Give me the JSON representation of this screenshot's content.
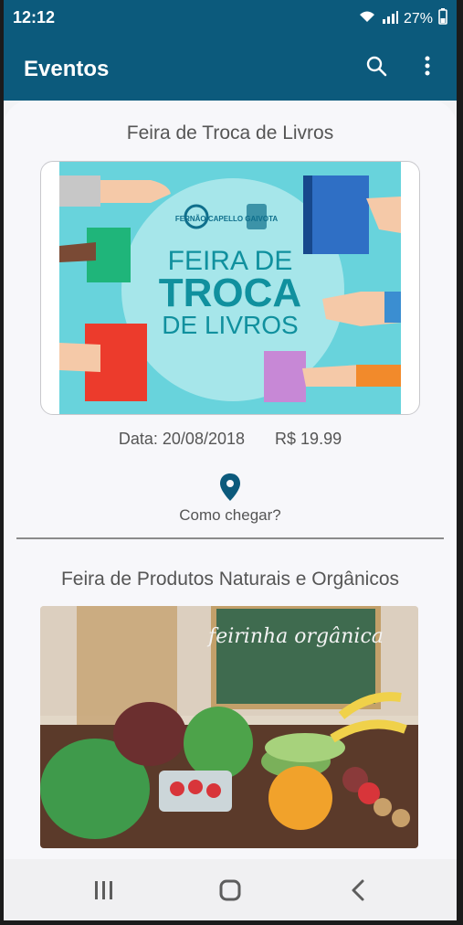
{
  "status": {
    "time": "12:12",
    "battery": "27%"
  },
  "appbar": {
    "title": "Eventos"
  },
  "events": [
    {
      "title": "Feira de Troca de Livros",
      "date_label": "Data: 20/08/2018",
      "price_label": "R$ 19.99",
      "directions": "Como chegar?",
      "banner": {
        "line1": "FEIRA DE",
        "line2": "TROCA",
        "line3": "DE LIVROS",
        "brand": "FERNÃO CAPELLO GAIVOTA"
      }
    },
    {
      "title": "Feira de Produtos Naturais e Orgânicos",
      "image_text": "feirinha orgânica"
    }
  ],
  "colors": {
    "primary": "#0c5a7c",
    "banner_bg": "#68d3dc",
    "banner_circle": "#a6e6ea",
    "title_text": "#10909e"
  }
}
